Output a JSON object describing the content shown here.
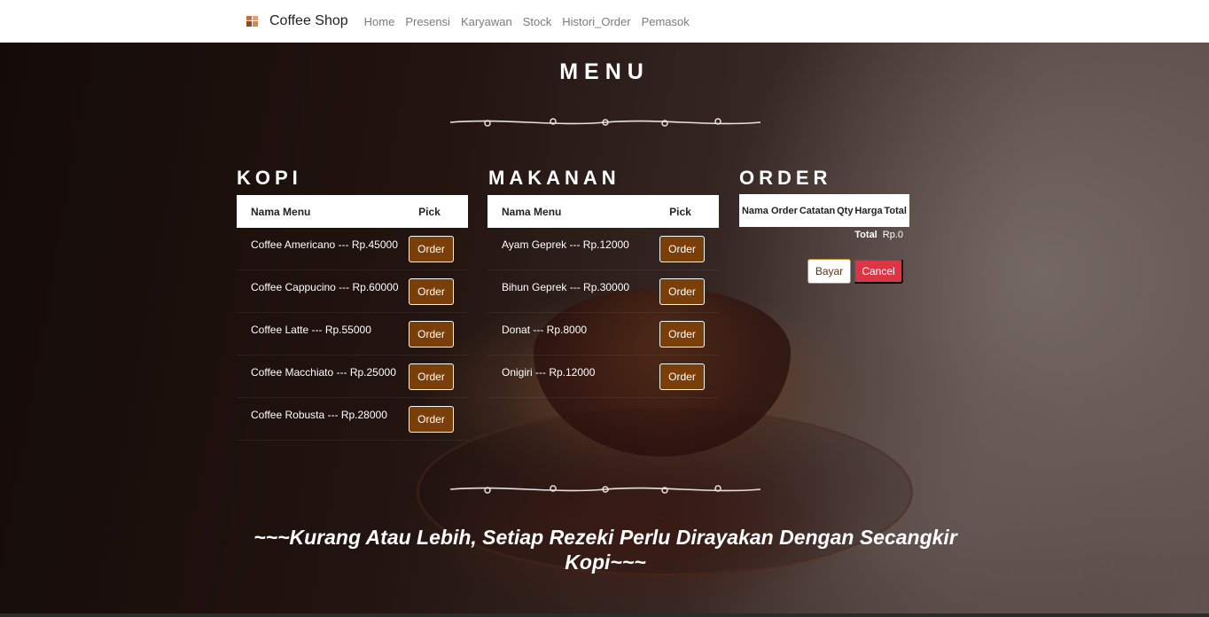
{
  "navbar": {
    "brand": "Coffee Shop",
    "links": [
      "Home",
      "Presensi",
      "Karyawan",
      "Stock",
      "Histori_Order",
      "Pemasok"
    ]
  },
  "menu_title": "MENU",
  "kopi": {
    "title": "KOPI",
    "header": {
      "name": "Nama Menu",
      "pick": "Pick"
    },
    "items": [
      {
        "label": "Coffee Americano --- Rp.45000",
        "button": "Order"
      },
      {
        "label": "Coffee Cappucino --- Rp.60000",
        "button": "Order"
      },
      {
        "label": "Coffee Latte --- Rp.55000",
        "button": "Order"
      },
      {
        "label": "Coffee Macchiato --- Rp.25000",
        "button": "Order"
      },
      {
        "label": "Coffee Robusta --- Rp.28000",
        "button": "Order"
      }
    ]
  },
  "makanan": {
    "title": "MAKANAN",
    "header": {
      "name": "Nama Menu",
      "pick": "Pick"
    },
    "items": [
      {
        "label": "Ayam Geprek --- Rp.12000",
        "button": "Order"
      },
      {
        "label": "Bihun Geprek --- Rp.30000",
        "button": "Order"
      },
      {
        "label": "Donat --- Rp.8000",
        "button": "Order"
      },
      {
        "label": "Onigiri --- Rp.12000",
        "button": "Order"
      }
    ]
  },
  "order": {
    "title": "ORDER",
    "columns": [
      "Nama Order",
      "Catatan",
      "Qty",
      "Harga",
      "Total"
    ],
    "total_label": "Total",
    "total_value": "Rp.0",
    "bayar": "Bayar",
    "cancel": "Cancel"
  },
  "quote": "~~~Kurang Atau Lebih, Setiap Rezeki Perlu Dirayakan Dengan Secangkir Kopi~~~",
  "colors": {
    "order_button": "#7a3e08",
    "cancel_button": "#dc3545",
    "navbar_bg": "#ffffff"
  }
}
